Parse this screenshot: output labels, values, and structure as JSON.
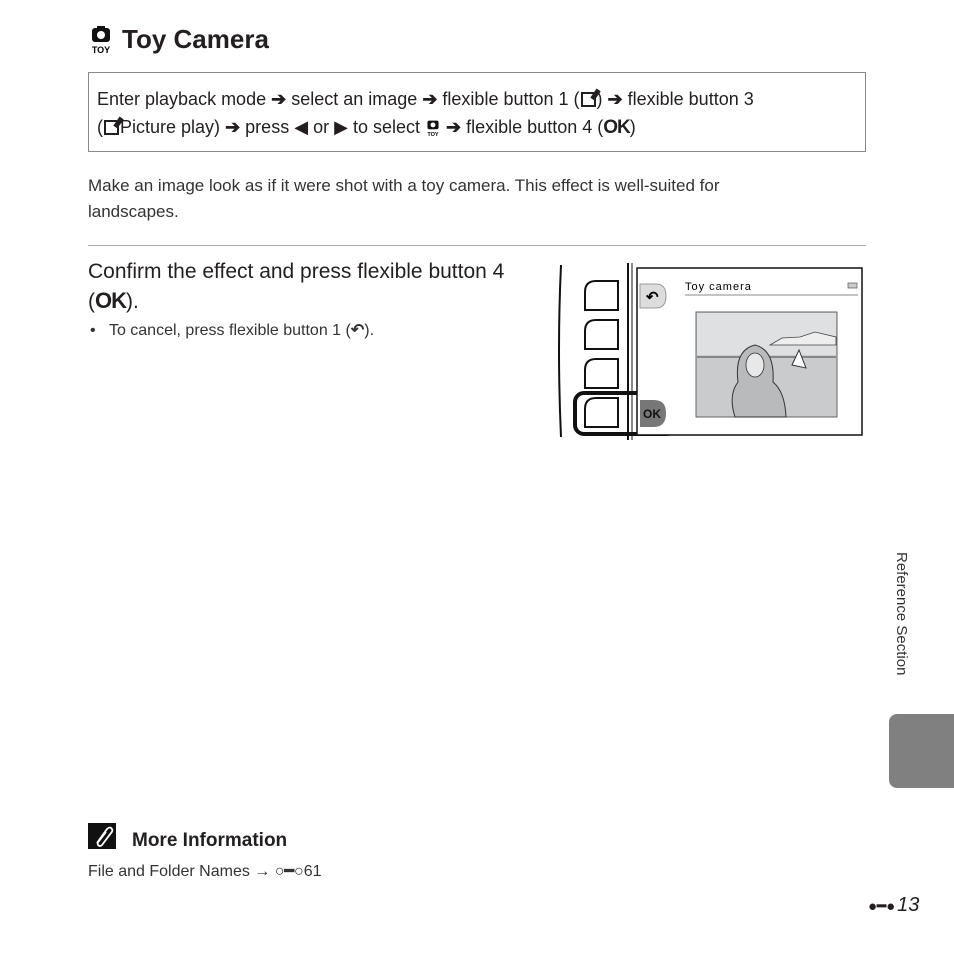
{
  "title": "Toy Camera",
  "instructions": {
    "line1": [
      "Enter playback mode",
      "select an image",
      "flexible button 1 (",
      ")",
      "flexible button 3"
    ],
    "line2": [
      "(",
      "Picture play)",
      "press",
      "or",
      "to select",
      "flexible button 4 (",
      "OK",
      ")"
    ]
  },
  "description": "Make an image look as if it were shot with a toy camera. This effect is well-suited for landscapes.",
  "step": {
    "text": "Confirm the effect and press flexible button 4 (",
    "ok": "OK",
    "end": ")."
  },
  "bullet": {
    "text": "To cancel, press flexible button 1 (",
    "end": ")."
  },
  "illustration": {
    "screen_title": "Toy camera",
    "ok_button": "OK"
  },
  "side_label": "Reference Section",
  "more_info": {
    "title": "More Information",
    "text": "File and Folder Names",
    "ref": "61"
  },
  "page_number": "13",
  "icons": {
    "title": "toy-camera-icon",
    "arrow": "arrow-right-bold",
    "left": "triangle-left",
    "right": "triangle-right",
    "back": "back-arrow-icon",
    "ref": "binoculars-icon"
  }
}
